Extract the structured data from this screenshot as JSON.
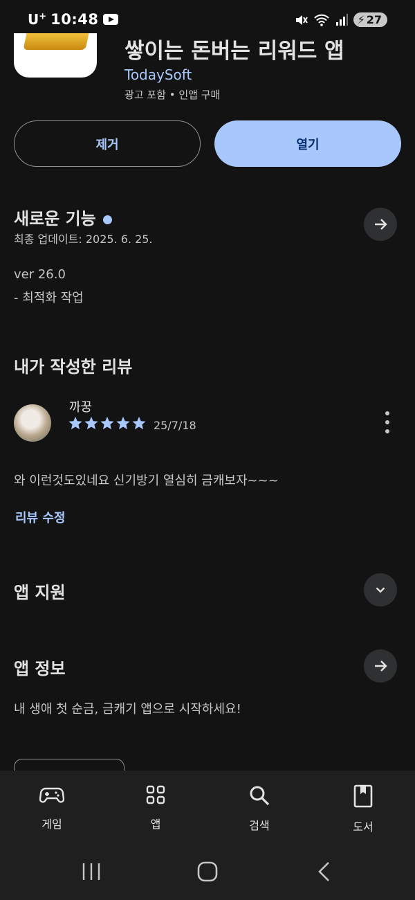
{
  "status_bar": {
    "carrier": "U",
    "carrier_sup": "+",
    "time": "10:48",
    "battery": "27"
  },
  "app": {
    "title": "쌓이는 돈버는 리워드 앱",
    "developer": "TodaySoft",
    "meta": "광고 포함 • 인앱 구매"
  },
  "actions": {
    "remove_label": "제거",
    "open_label": "열기"
  },
  "whats_new": {
    "title": "새로운 기능",
    "updated": "최종 업데이트: 2025. 6. 25.",
    "version": "ver 26.0",
    "note": "- 최적화 작업"
  },
  "my_review": {
    "title": "내가 작성한 리뷰",
    "reviewer": "까꿍",
    "rating": 5,
    "date": "25/7/18",
    "text": "와 이런것도있네요 신기방기 열심히 금캐보자~~~",
    "edit_label": "리뷰 수정"
  },
  "app_support": {
    "title": "앱 지원"
  },
  "app_info": {
    "title": "앱 정보",
    "description": "내 생애 첫 순금, 금캐기 앱으로 시작하세요!"
  },
  "bottom_nav": [
    {
      "label": "게임",
      "icon": "gamepad-icon"
    },
    {
      "label": "앱",
      "icon": "apps-grid-icon"
    },
    {
      "label": "검색",
      "icon": "search-icon"
    },
    {
      "label": "도서",
      "icon": "book-icon"
    }
  ],
  "colors": {
    "background": "#131314",
    "accent": "#a8c7fa",
    "surface": "#1f1f20",
    "button_circle": "#2f3031"
  }
}
